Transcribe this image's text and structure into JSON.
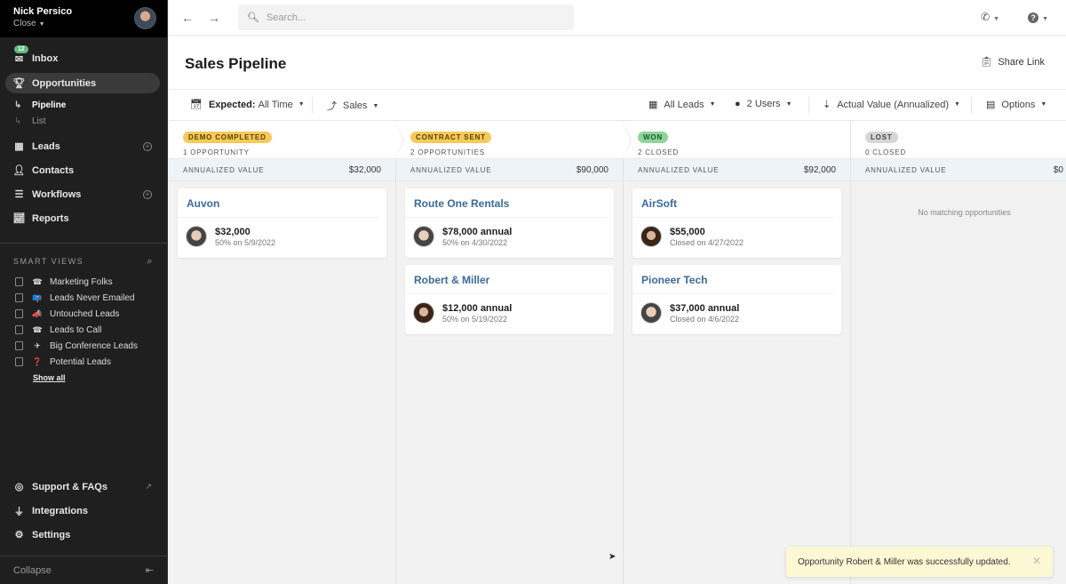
{
  "sidebar": {
    "user_name": "Nick Persico",
    "org_name": "Close",
    "nav": [
      {
        "label": "Inbox",
        "icon": "inbox-icon",
        "badge": "12"
      },
      {
        "label": "Opportunities",
        "icon": "trophy-icon",
        "active": true
      },
      {
        "label": "Leads",
        "icon": "building-icon",
        "add": true
      },
      {
        "label": "Contacts",
        "icon": "person-icon"
      },
      {
        "label": "Workflows",
        "icon": "list-icon",
        "add": true
      },
      {
        "label": "Reports",
        "icon": "chart-icon"
      }
    ],
    "opportunities_sub": [
      {
        "label": "Pipeline",
        "active": true
      },
      {
        "label": "List"
      }
    ],
    "smart_views_title": "SMART VIEWS",
    "smart_views": [
      {
        "label": "Marketing Folks",
        "emoji": "☎"
      },
      {
        "label": "Leads Never Emailed",
        "emoji": "📪"
      },
      {
        "label": "Untouched Leads",
        "emoji": "📣"
      },
      {
        "label": "Leads to Call",
        "emoji": "☎"
      },
      {
        "label": "Big Conference Leads",
        "emoji": "✈"
      },
      {
        "label": "Potential Leads",
        "emoji": "❓"
      }
    ],
    "show_all": "Show all",
    "bottom": [
      {
        "label": "Support & FAQs",
        "icon": "lifebuoy-icon",
        "external": true
      },
      {
        "label": "Integrations",
        "icon": "plug-icon"
      },
      {
        "label": "Settings",
        "icon": "gear-icon"
      }
    ],
    "collapse": "Collapse"
  },
  "topbar": {
    "search_placeholder": "Search..."
  },
  "header": {
    "title": "Sales Pipeline",
    "share_link": "Share Link"
  },
  "filters": {
    "expected_label": "Expected:",
    "expected_value": "All Time",
    "pipeline": "Sales",
    "leads": "All Leads",
    "users": "2 Users",
    "sort": "Actual Value (Annualized)",
    "options": "Options"
  },
  "columns": [
    {
      "stage": "DEMO COMPLETED",
      "pill_bg": "#f6c95a",
      "pill_fg": "#5a4300",
      "count": "1 OPPORTUNITY",
      "value_label": "ANNUALIZED VALUE",
      "value": "$32,000",
      "cards": [
        {
          "name": "Auvon",
          "amount": "$32,000",
          "detail": "50% on 5/9/2022",
          "avatar": "m"
        }
      ]
    },
    {
      "stage": "CONTRACT SENT",
      "pill_bg": "#f6c95a",
      "pill_fg": "#5a4300",
      "count": "2 OPPORTUNITIES",
      "value_label": "ANNUALIZED VALUE",
      "value": "$90,000",
      "cards": [
        {
          "name": "Route One Rentals",
          "amount": "$78,000 annual",
          "detail": "50% on 4/30/2022",
          "avatar": "m"
        },
        {
          "name": "Robert & Miller",
          "amount": "$12,000 annual",
          "detail": "50% on 5/19/2022",
          "avatar": "f"
        }
      ]
    },
    {
      "stage": "WON",
      "pill_bg": "#8fd49a",
      "pill_fg": "#1f5a2a",
      "count": "2 CLOSED",
      "value_label": "ANNUALIZED VALUE",
      "value": "$92,000",
      "cards": [
        {
          "name": "AirSoft",
          "amount": "$55,000",
          "detail": "Closed on 4/27/2022",
          "avatar": "f"
        },
        {
          "name": "Pioneer Tech",
          "amount": "$37,000 annual",
          "detail": "Closed on 4/6/2022",
          "avatar": "m"
        }
      ]
    },
    {
      "stage": "LOST",
      "pill_bg": "#d6d6d6",
      "pill_fg": "#444",
      "count": "0 CLOSED",
      "value_label": "ANNUALIZED VALUE",
      "value": "$0",
      "cards": [],
      "empty": "No matching opportunities"
    }
  ],
  "toast": {
    "message": "Opportunity Robert & Miller was successfully updated."
  }
}
